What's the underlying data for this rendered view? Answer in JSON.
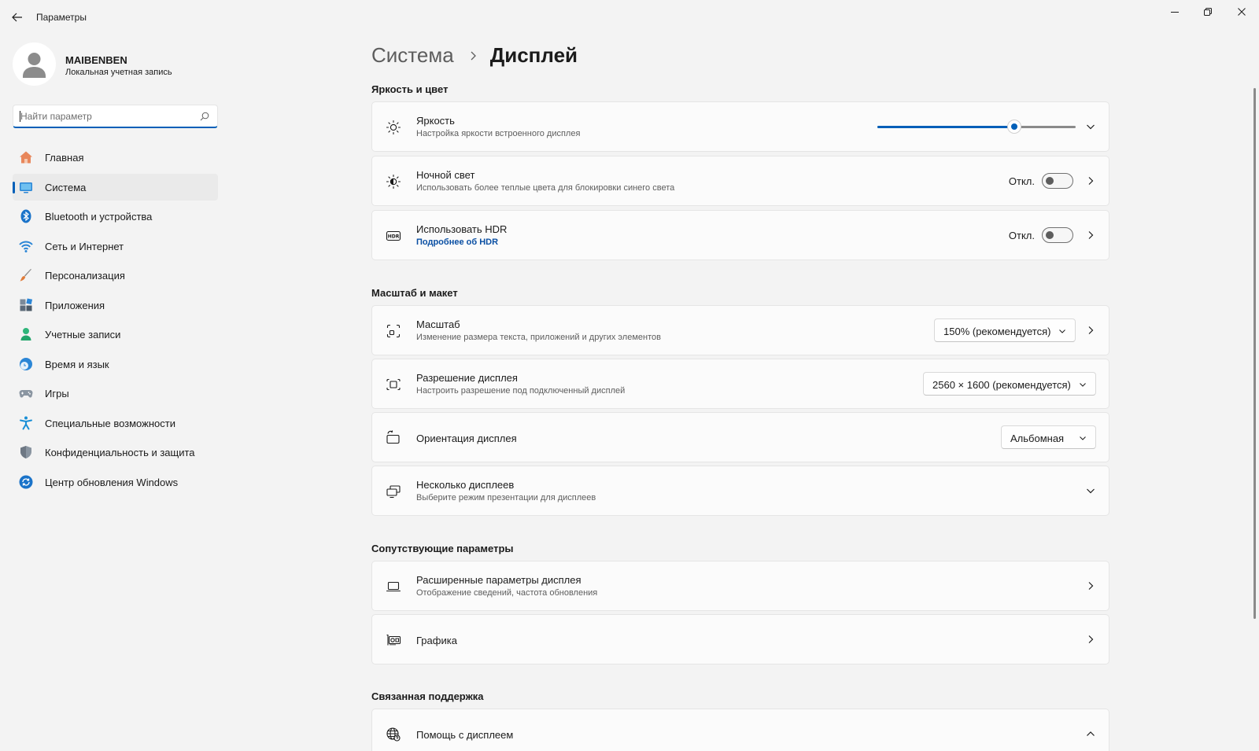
{
  "window": {
    "title": "Параметры"
  },
  "user": {
    "name": "MAIBENBEN",
    "account_type": "Локальная учетная запись"
  },
  "search": {
    "placeholder": "Найти параметр"
  },
  "nav": [
    {
      "label": "Главная",
      "icon": "home-icon"
    },
    {
      "label": "Система",
      "icon": "system-icon",
      "active": true
    },
    {
      "label": "Bluetooth и устройства",
      "icon": "bluetooth-icon"
    },
    {
      "label": "Сеть и Интернет",
      "icon": "wifi-icon"
    },
    {
      "label": "Персонализация",
      "icon": "brush-icon"
    },
    {
      "label": "Приложения",
      "icon": "apps-icon"
    },
    {
      "label": "Учетные записи",
      "icon": "accounts-icon"
    },
    {
      "label": "Время и язык",
      "icon": "time-language-icon"
    },
    {
      "label": "Игры",
      "icon": "gamepad-icon"
    },
    {
      "label": "Специальные возможности",
      "icon": "accessibility-icon"
    },
    {
      "label": "Конфиденциальность и защита",
      "icon": "shield-icon"
    },
    {
      "label": "Центр обновления Windows",
      "icon": "update-icon"
    }
  ],
  "breadcrumb": {
    "parent": "Система",
    "current": "Дисплей"
  },
  "sections": {
    "brightness_color": {
      "title": "Яркость и цвет",
      "brightness": {
        "title": "Яркость",
        "subtitle": "Настройка яркости встроенного дисплея",
        "level": 0.69
      },
      "night_light": {
        "title": "Ночной свет",
        "subtitle": "Использовать более теплые цвета для блокировки синего света",
        "state": "Откл."
      },
      "hdr": {
        "title": "Использовать HDR",
        "link": "Подробнее об HDR",
        "state": "Откл."
      }
    },
    "scale_layout": {
      "title": "Масштаб и макет",
      "scale": {
        "title": "Масштаб",
        "subtitle": "Изменение размера текста, приложений и других элементов",
        "value": "150% (рекомендуется)"
      },
      "resolution": {
        "title": "Разрешение дисплея",
        "subtitle": "Настроить разрешение под подключенный дисплей",
        "value": "2560 × 1600 (рекомендуется)"
      },
      "orientation": {
        "title": "Ориентация дисплея",
        "value": "Альбомная"
      },
      "multiple": {
        "title": "Несколько дисплеев",
        "subtitle": "Выберите режим презентации для дисплеев"
      }
    },
    "related": {
      "title": "Сопутствующие параметры",
      "advanced": {
        "title": "Расширенные параметры дисплея",
        "subtitle": "Отображение сведений, частота обновления"
      },
      "graphics": {
        "title": "Графика"
      }
    },
    "support": {
      "title": "Связанная поддержка",
      "help": {
        "title": "Помощь с дисплеем"
      }
    }
  },
  "colors": {
    "accent": "#005fb8",
    "background": "#f3f3f3",
    "card": "#fbfbfb"
  }
}
